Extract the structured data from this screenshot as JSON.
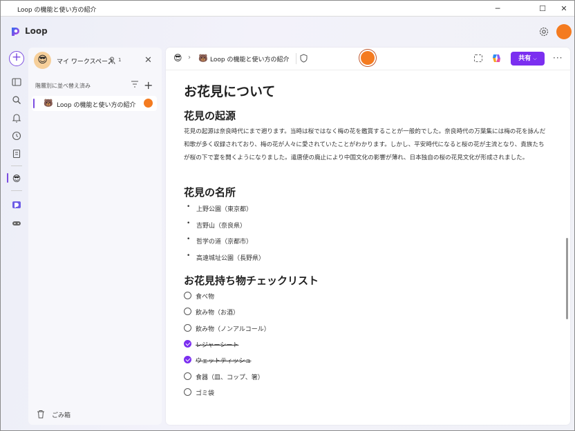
{
  "window": {
    "title": "Loop の機能と使い方の紹介",
    "minimize": "─",
    "maximize": "☐",
    "close": "✕"
  },
  "app": {
    "name": "Loop"
  },
  "workspace": {
    "name": "マイ ワークスペース",
    "member_count": "1",
    "avatar_emoji": "😎"
  },
  "sidebar": {
    "sort_label": "階層別に並べ替え済み",
    "pages": [
      {
        "emoji": "🐻",
        "label": "Loop の機能と使い方の紹介"
      }
    ],
    "trash_label": "ごみ箱"
  },
  "breadcrumb": {
    "workspace_emoji": "😎",
    "page_emoji": "🐻",
    "page_label": "Loop の機能と使い方の紹介"
  },
  "toolbar": {
    "share_label": "共有",
    "more_label": "···"
  },
  "document": {
    "title": "お花見について",
    "sections": [
      {
        "heading": "花見の起源",
        "paragraph": "花見の起源は奈良時代にまで遡ります。当時は桜ではなく梅の花を鑑賞することが一般的でした。奈良時代の万葉集には梅の花を詠んだ和歌が多く収録されており、梅の花が人々に愛されていたことがわかります。しかし、平安時代になると桜の花が主流となり、貴族たちが桜の下で宴を開くようになりました。遣唐使の廃止により中国文化の影響が薄れ、日本独自の桜の花見文化が形成されました。"
      },
      {
        "heading": "花見の名所",
        "bullets": [
          "上野公園（東京都）",
          "吉野山（奈良県）",
          "哲学の道（京都市）",
          "高遠城址公園（長野県）"
        ]
      },
      {
        "heading": "お花見持ち物チェックリスト",
        "checklist": [
          {
            "label": "食べ物",
            "checked": false
          },
          {
            "label": "飲み物（お酒）",
            "checked": false
          },
          {
            "label": "飲み物（ノンアルコール）",
            "checked": false
          },
          {
            "label": "レジャーシート",
            "checked": true
          },
          {
            "label": "ウェットティッシュ",
            "checked": true
          },
          {
            "label": "食器（皿、コップ、箸）",
            "checked": false
          },
          {
            "label": "ゴミ袋",
            "checked": false
          }
        ]
      }
    ]
  },
  "colors": {
    "accent": "#7b2ff0",
    "avatar": "#f47b20"
  }
}
